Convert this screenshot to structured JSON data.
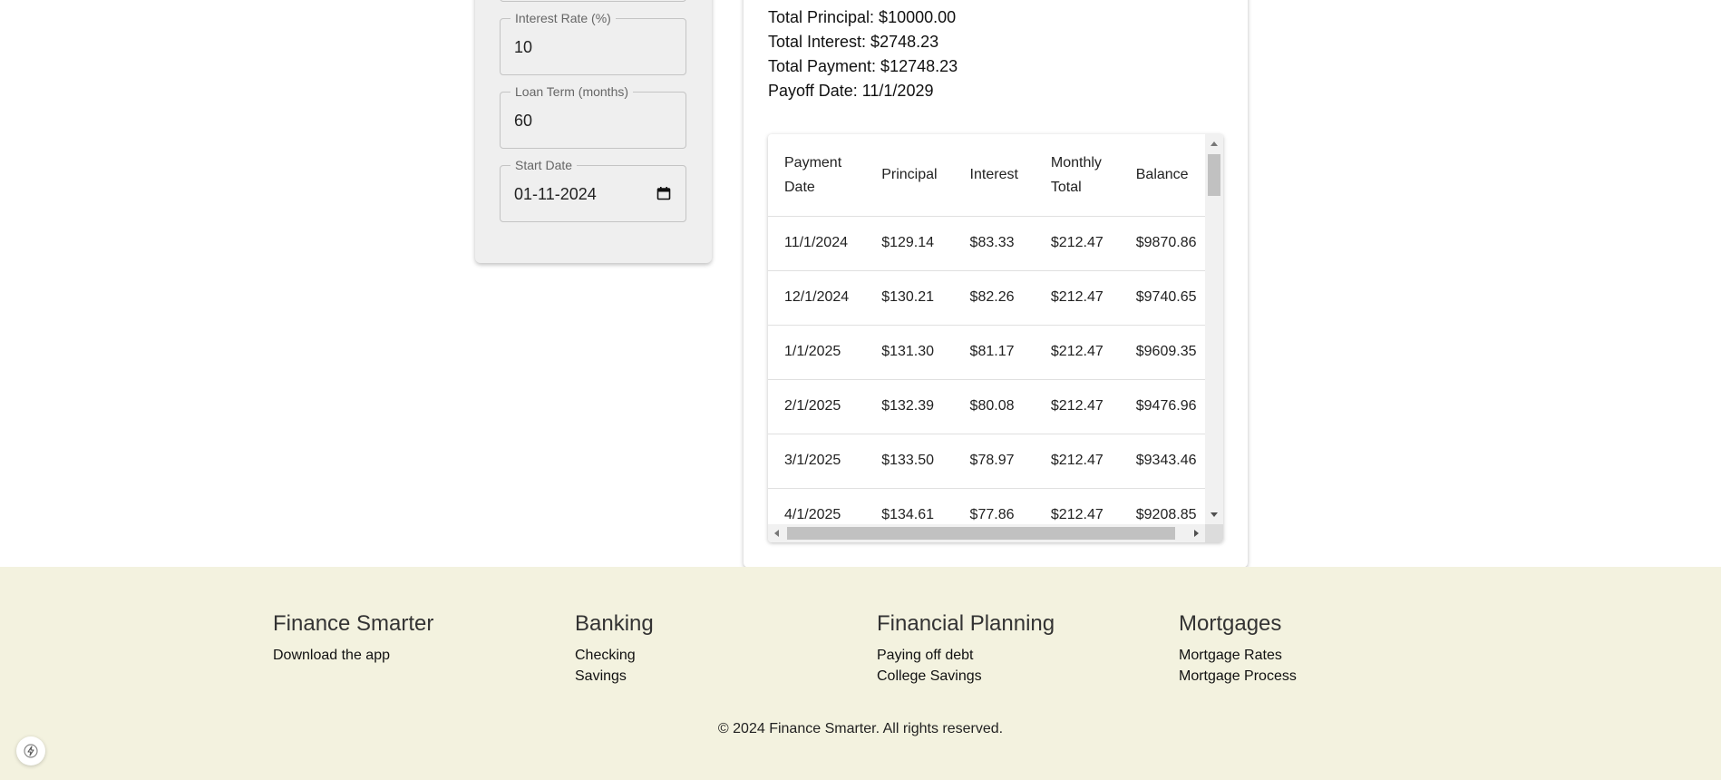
{
  "inputs": {
    "interest_rate": {
      "label": "Interest Rate (%)",
      "value": "10"
    },
    "loan_term": {
      "label": "Loan Term (months)",
      "value": "60"
    },
    "start_date": {
      "label": "Start Date",
      "value": "01-11-2024"
    }
  },
  "summary": {
    "total_principal": "Total Principal: $10000.00",
    "total_interest": "Total Interest: $2748.23",
    "total_payment": "Total Payment: $12748.23",
    "payoff_date": "Payoff Date: 11/1/2029"
  },
  "schedule": {
    "headers": [
      "Payment Date",
      "Principal",
      "Interest",
      "Monthly Total",
      "Balance"
    ],
    "rows": [
      [
        "11/1/2024",
        "$129.14",
        "$83.33",
        "$212.47",
        "$9870.86"
      ],
      [
        "12/1/2024",
        "$130.21",
        "$82.26",
        "$212.47",
        "$9740.65"
      ],
      [
        "1/1/2025",
        "$131.30",
        "$81.17",
        "$212.47",
        "$9609.35"
      ],
      [
        "2/1/2025",
        "$132.39",
        "$80.08",
        "$212.47",
        "$9476.96"
      ],
      [
        "3/1/2025",
        "$133.50",
        "$78.97",
        "$212.47",
        "$9343.46"
      ],
      [
        "4/1/2025",
        "$134.61",
        "$77.86",
        "$212.47",
        "$9208.85"
      ]
    ]
  },
  "footer": {
    "columns": [
      {
        "title": "Finance Smarter",
        "links": [
          "Download the app"
        ]
      },
      {
        "title": "Banking",
        "links": [
          "Checking",
          "Savings"
        ]
      },
      {
        "title": "Financial Planning",
        "links": [
          "Paying off debt",
          "College Savings"
        ]
      },
      {
        "title": "Mortgages",
        "links": [
          "Mortgage Rates",
          "Mortgage Process"
        ]
      }
    ],
    "copyright": "© 2024 Finance Smarter. All rights reserved."
  },
  "colors": {
    "footer_bg": "#f3f2df",
    "panel_bg": "#efefef"
  },
  "icons": {
    "date_picker": "calendar-icon",
    "dev_tool": "bolt-icon"
  }
}
